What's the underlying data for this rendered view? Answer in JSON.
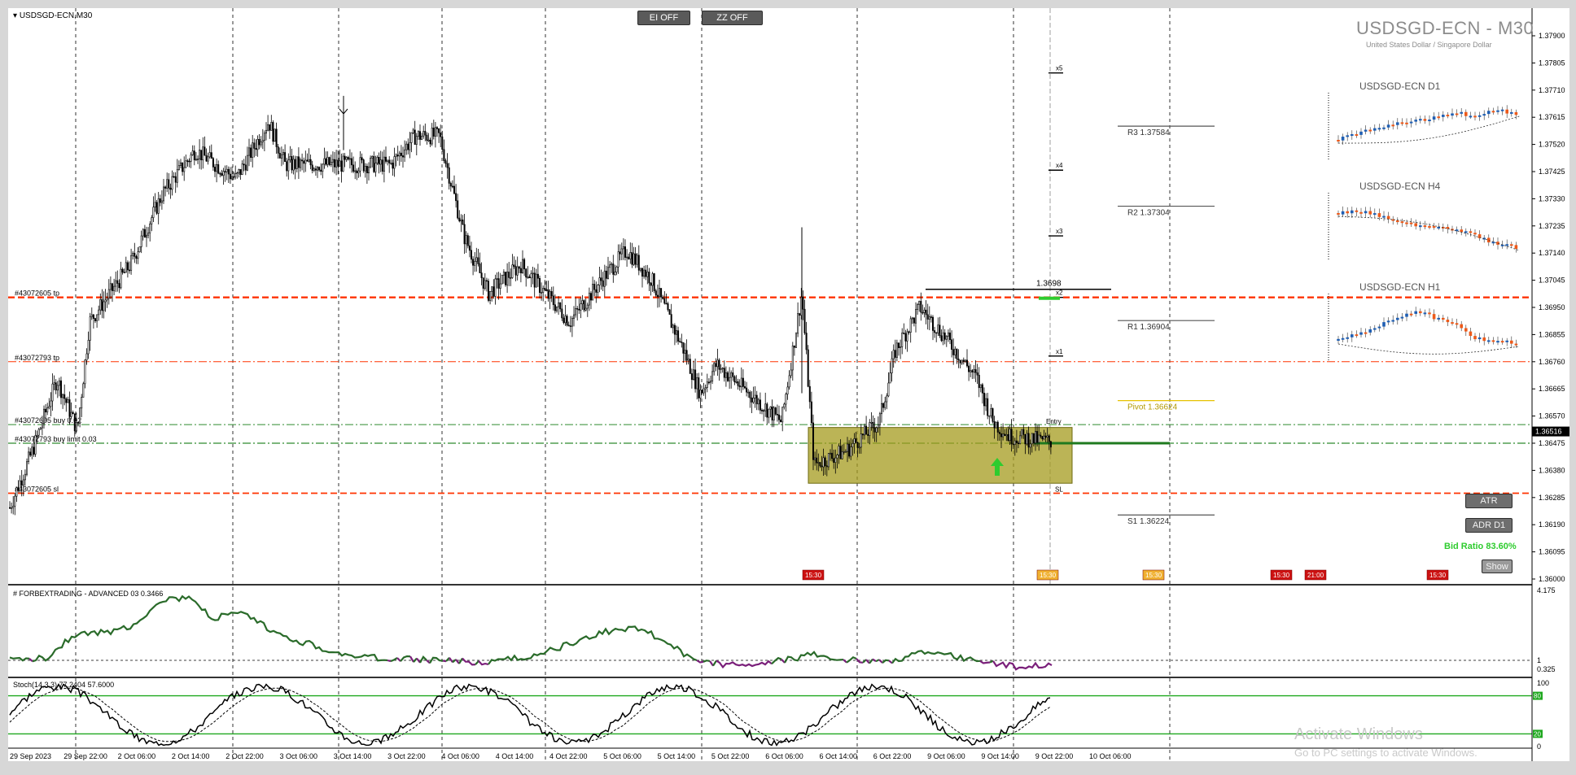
{
  "window": {
    "symbol_label": "USDSGD-ECN,M30",
    "title": "USDSGD-ECN - M30",
    "subtitle": "United States Dollar / Singapore Dollar"
  },
  "toolbar": {
    "ei_label": "EI OFF",
    "zz_label": "ZZ OFF"
  },
  "price_axis": {
    "labels": [
      "1.37900",
      "1.37805",
      "1.37710",
      "1.37615",
      "1.37520",
      "1.37425",
      "1.37330",
      "1.37235",
      "1.37140",
      "1.37045",
      "1.36950",
      "1.36855",
      "1.36760",
      "1.36665",
      "1.36570",
      "1.36475",
      "1.36380",
      "1.36285",
      "1.36190",
      "1.36095",
      "1.36000"
    ],
    "current_price": "1.36516"
  },
  "time_axis": {
    "labels": [
      "29 Sep 2023",
      "29 Sep 22:00",
      "2 Oct 06:00",
      "2 Oct 14:00",
      "2 Oct 22:00",
      "3 Oct 06:00",
      "3 Oct 14:00",
      "3 Oct 22:00",
      "4 Oct 06:00",
      "4 Oct 14:00",
      "4 Oct 22:00",
      "5 Oct 06:00",
      "5 Oct 14:00",
      "5 Oct 22:00",
      "6 Oct 06:00",
      "6 Oct 14:00",
      "6 Oct 22:00",
      "9 Oct 06:00",
      "9 Oct 14:00",
      "9 Oct 22:00",
      "10 Oct 06:00"
    ]
  },
  "order_labels": {
    "tp1": "#43072605 tp",
    "tp2": "#43072793 tp",
    "buy1": "#43072605 buy 0.02",
    "buy2": "#43072793 buy limit 0.03",
    "sl": "#43072605 sl"
  },
  "levels": {
    "r3": "R3 1.37584",
    "r2": "R2 1.37304",
    "r1": "R1 1.36904",
    "pivot": "Pivot 1.36624",
    "s1": "S1 1.36224",
    "high": "1.3698",
    "x5": "x5",
    "x4": "x4",
    "x3": "x3",
    "x2": "x2",
    "x1": "x1",
    "entry": "Entry",
    "sl_tag": "SL"
  },
  "mini_charts": {
    "d1": "USDSGD-ECN D1",
    "h4": "USDSGD-ECN H4",
    "h1": "USDSGD-ECN H1"
  },
  "news_flags": [
    "15:30",
    "15:30",
    "15:30",
    "15:30",
    "21:00",
    "15:30"
  ],
  "side_buttons": {
    "atr": "ATR",
    "adr": "ADR D1",
    "show": "Show"
  },
  "bid_ratio": "Bid Ratio 83.60%",
  "indicator1": {
    "label": "# FORBEXTRADING - ADVANCED 03 0.3466",
    "axis": [
      "4.175",
      "1",
      "0.325"
    ]
  },
  "indicator2": {
    "label": "Stoch(14,3,3) 77.2404 57.6000",
    "axis": [
      "100",
      "80",
      "20",
      "0"
    ]
  },
  "colors": {
    "candle": "#000000",
    "tp_line": "#ff3300",
    "entry_line": "#2e8b2e",
    "zone": "#a49b1e",
    "bull": "#1f5fb4",
    "bear": "#ee5a1a",
    "stoch": "#1fa81f",
    "osc_green": "#2a6b2a",
    "osc_purple": "#7a1f7a"
  },
  "watermark": {
    "line1": "Activate Windows",
    "line2": "Go to PC settings to activate Windows."
  }
}
